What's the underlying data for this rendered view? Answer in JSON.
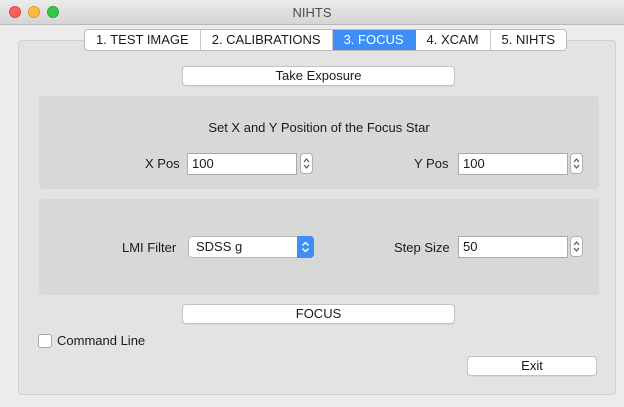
{
  "window": {
    "title": "NIHTS"
  },
  "tabs": [
    {
      "label": "1. TEST IMAGE",
      "active": false
    },
    {
      "label": "2. CALIBRATIONS",
      "active": false
    },
    {
      "label": "3. FOCUS",
      "active": true
    },
    {
      "label": "4. XCAM",
      "active": false
    },
    {
      "label": "5. NIHTS",
      "active": false
    }
  ],
  "focus": {
    "take_exposure_label": "Take Exposure",
    "position_heading": "Set X and Y Position of the Focus Star",
    "x_pos_label": "X Pos",
    "x_pos_value": "100",
    "y_pos_label": "Y Pos",
    "y_pos_value": "100",
    "filter_label": "LMI Filter",
    "filter_value": "SDSS g",
    "step_size_label": "Step Size",
    "step_size_value": "50",
    "focus_label": "FOCUS",
    "command_line_label": "Command Line",
    "command_line_checked": false,
    "exit_label": "Exit"
  },
  "colors": {
    "accent": "#3d8ef6"
  }
}
